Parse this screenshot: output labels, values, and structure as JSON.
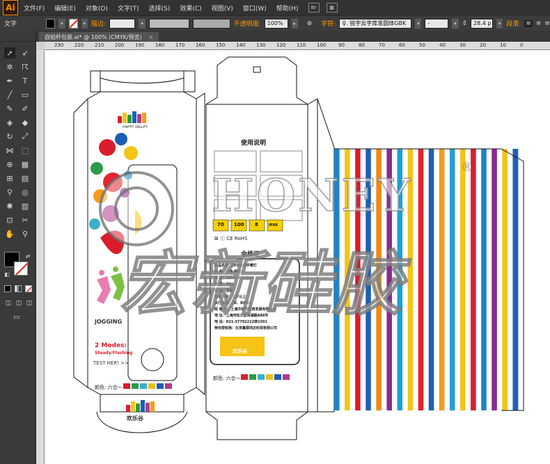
{
  "app": {
    "logo": "Ai"
  },
  "menu": [
    "文件(F)",
    "编辑(E)",
    "对象(O)",
    "文字(T)",
    "选择(S)",
    "效果(C)",
    "视图(V)",
    "窗口(W)",
    "帮助(H)"
  ],
  "menu_icons": {
    "bridge": "Br"
  },
  "control_bar": {
    "tool_label": "文字",
    "stroke_label": "描边:",
    "opacity_label": "不透明度:",
    "opacity_value": "100%",
    "char_label": "字符:",
    "font_value": "♀. 锐字云字库准圆体GBK",
    "style_value": "-",
    "size_value": "28.4 p",
    "para_label": "段落:"
  },
  "document_tab": {
    "title": "自拍杆包装.ai* @ 100% (CMYK/预览)",
    "close": "×"
  },
  "ruler": {
    "ticks": [
      "230",
      "220",
      "210",
      "200",
      "190",
      "180",
      "170",
      "160",
      "150",
      "140",
      "130",
      "120",
      "110",
      "100",
      "90",
      "80",
      "70",
      "60",
      "50",
      "40",
      "30",
      "20",
      "10",
      "0"
    ]
  },
  "artwork": {
    "brand_small": "HAPPY VALLEY",
    "brand_cn": "欢乐谷",
    "jogging": "JOGGING",
    "modes_title": "2 Modes:",
    "modes_sub": "Steady/Flashing",
    "test_here": "TEST HER! >>",
    "colors_label": "颜色: 六合一",
    "swatch_colors": [
      "#d81e2c",
      "#2b9b46",
      "#3ab0c7",
      "#e6c21f",
      "#1e5fb5",
      "#b03a8c"
    ],
    "usage_title": "使用说明",
    "spec_badges": [
      "70",
      "100",
      "8"
    ],
    "spec_badge_4": "IPX8",
    "cert_marks": "⊠ ⓒ CE RoHS",
    "cert_title": "合格证",
    "cert_lines": [
      "商品名称：LED运动手臂灯",
      "颜    色：六色/颜均",
      "规    格：18cm X 3.5cm",
      "重    量：68g",
      "材    质：塑胶",
      "适用年龄：三岁以上",
      "执行标准：CE、ROHS",
      "经 销 商：上海华林城投资发展有限公司",
      "地    址：上海市松江区林湖路888号",
      "电    话：021-37792222转1501",
      "特许授权商：北京鑫源鸿达科贸有限公司"
    ],
    "watermark_en": "HONEY",
    "watermark_reg": "®",
    "watermark_cn": "宏新硅胶"
  },
  "stripes": [
    "#1e84c8",
    "#ffffff",
    "#f5c416",
    "#ffffff",
    "#d81e2c",
    "#ffffff",
    "#1e5fb5",
    "#ffffff",
    "#ef8a1a",
    "#ffffff",
    "#8a2a8c",
    "#ffffff",
    "#1ea0d8",
    "#ffffff",
    "#f5c416",
    "#ffffff",
    "#e0262e",
    "#ffffff",
    "#1e5fb5",
    "#ffffff",
    "#f59c1a",
    "#ffffff",
    "#2b9bd6",
    "#ffffff",
    "#f5c416",
    "#ffffff",
    "#d81e2c",
    "#ffffff",
    "#1e84c8",
    "#ffffff",
    "#8a2a8c",
    "#ffffff",
    "#f5c416",
    "#ffffff",
    "#1e5fb5"
  ]
}
